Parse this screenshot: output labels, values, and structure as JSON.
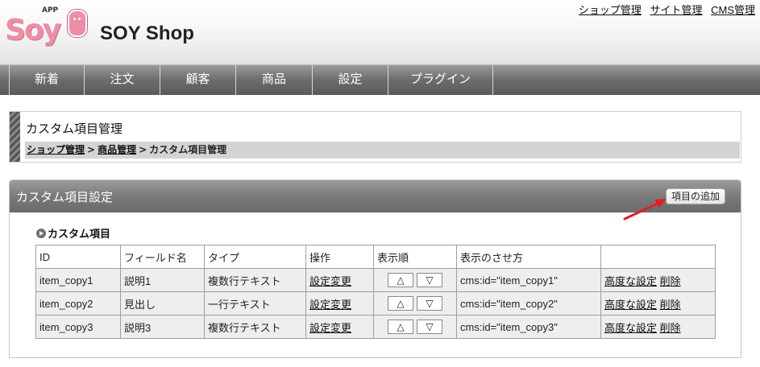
{
  "header": {
    "logo_app": "APP",
    "logo_text": "Soy",
    "site_title": "SOY Shop",
    "top_links": [
      "ショップ管理",
      "サイト管理",
      "CMS管理"
    ]
  },
  "nav": [
    {
      "label": "新着"
    },
    {
      "label": "注文"
    },
    {
      "label": "顧客"
    },
    {
      "label": "商品"
    },
    {
      "label": "設定"
    },
    {
      "label": "プラグイン"
    }
  ],
  "page": {
    "title": "カスタム項目管理",
    "breadcrumb": [
      "ショップ管理",
      "商品管理",
      "カスタム項目管理"
    ],
    "breadcrumb_sep": ">"
  },
  "panel": {
    "title": "カスタム項目設定",
    "add_button": "項目の追加",
    "section_label": "カスタム項目"
  },
  "table": {
    "headers": [
      "ID",
      "フィールド名",
      "タイプ",
      "操作",
      "表示順",
      "表示のさせ方",
      ""
    ],
    "rows": [
      {
        "id": "item_copy1",
        "name": "説明1",
        "type": "複数行テキスト",
        "edit": "設定変更",
        "up": "△",
        "down": "▽",
        "display": "cms:id=\"item_copy1\"",
        "advanced": "高度な設定",
        "delete": "削除"
      },
      {
        "id": "item_copy2",
        "name": "見出し",
        "type": "一行テキスト",
        "edit": "設定変更",
        "up": "△",
        "down": "▽",
        "display": "cms:id=\"item_copy2\"",
        "advanced": "高度な設定",
        "delete": "削除"
      },
      {
        "id": "item_copy3",
        "name": "説明3",
        "type": "複数行テキスト",
        "edit": "設定変更",
        "up": "△",
        "down": "▽",
        "display": "cms:id=\"item_copy3\"",
        "advanced": "高度な設定",
        "delete": "削除"
      }
    ]
  },
  "colors": {
    "logo_pink": "#ec8fa6",
    "nav_bg": "#6c6c6c",
    "arrow_red": "#e02020"
  }
}
